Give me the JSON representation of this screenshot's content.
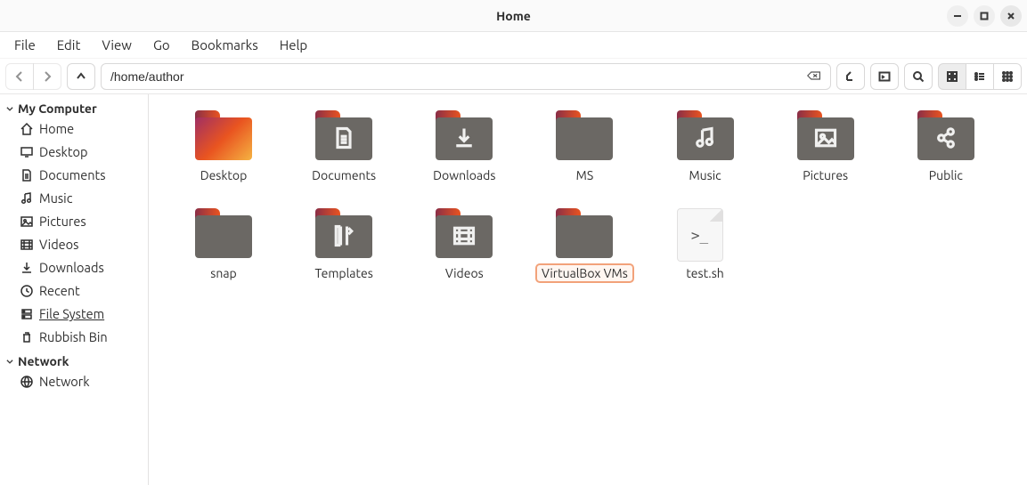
{
  "window": {
    "title": "Home"
  },
  "menubar": {
    "items": [
      "File",
      "Edit",
      "View",
      "Go",
      "Bookmarks",
      "Help"
    ]
  },
  "toolbar": {
    "path_value": "/home/author"
  },
  "sidebar": {
    "sections": [
      {
        "label": "My Computer",
        "items": [
          {
            "icon": "home",
            "label": "Home"
          },
          {
            "icon": "desktop",
            "label": "Desktop"
          },
          {
            "icon": "document",
            "label": "Documents"
          },
          {
            "icon": "music",
            "label": "Music"
          },
          {
            "icon": "picture",
            "label": "Pictures"
          },
          {
            "icon": "video",
            "label": "Videos"
          },
          {
            "icon": "download",
            "label": "Downloads"
          },
          {
            "icon": "recent",
            "label": "Recent"
          },
          {
            "icon": "filesystem",
            "label": "File System",
            "underline": true
          },
          {
            "icon": "trash",
            "label": "Rubbish Bin"
          }
        ]
      },
      {
        "label": "Network",
        "items": [
          {
            "icon": "globe",
            "label": "Network"
          }
        ]
      }
    ]
  },
  "content": {
    "items": [
      {
        "type": "folder",
        "variant": "gradient",
        "glyph": "none",
        "label": "Desktop"
      },
      {
        "type": "folder",
        "variant": "plain",
        "glyph": "document",
        "label": "Documents"
      },
      {
        "type": "folder",
        "variant": "plain",
        "glyph": "download",
        "label": "Downloads"
      },
      {
        "type": "folder",
        "variant": "plain",
        "glyph": "none",
        "label": "MS"
      },
      {
        "type": "folder",
        "variant": "plain",
        "glyph": "music",
        "label": "Music"
      },
      {
        "type": "folder",
        "variant": "plain",
        "glyph": "picture",
        "label": "Pictures"
      },
      {
        "type": "folder",
        "variant": "plain",
        "glyph": "share",
        "label": "Public"
      },
      {
        "type": "folder",
        "variant": "plain",
        "glyph": "none",
        "label": "snap"
      },
      {
        "type": "folder",
        "variant": "plain",
        "glyph": "template",
        "label": "Templates"
      },
      {
        "type": "folder",
        "variant": "plain",
        "glyph": "video",
        "label": "Videos"
      },
      {
        "type": "folder",
        "variant": "plain",
        "glyph": "none",
        "label": "VirtualBox VMs",
        "selected": true
      },
      {
        "type": "file",
        "variant": "script",
        "glyph": "terminal",
        "label": "test.sh"
      }
    ]
  }
}
